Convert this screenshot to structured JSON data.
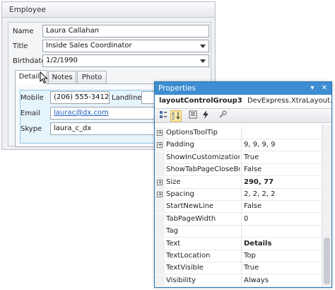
{
  "employee": {
    "group_title": "Employee",
    "name_label": "Name",
    "name_value": "Laura Callahan",
    "title_label": "Title",
    "title_value": "Inside Sales Coordinator",
    "birthdate_label": "Birthdate",
    "birthdate_value": "1/2/1990",
    "tabs": [
      {
        "label": "Details"
      },
      {
        "label": "Notes"
      },
      {
        "label": "Photo"
      }
    ],
    "mobile_label": "Mobile",
    "mobile_value": "(206) 555-3412",
    "landline_label": "Landline",
    "email_label": "Email",
    "email_value": "laurac@dx.com",
    "skype_label": "Skype",
    "skype_value": "laura_c_dx"
  },
  "properties": {
    "title": "Properties",
    "pin_glyph": "▾",
    "close_glyph": "✕",
    "object_name": "layoutControlGroup3",
    "object_type": "DevExpress.XtraLayout.Layout",
    "rows": [
      {
        "name": "OptionsToolTip",
        "value": "",
        "expandable": true
      },
      {
        "name": "Padding",
        "value": "9, 9, 9, 9",
        "expandable": true
      },
      {
        "name": "ShowInCustomization",
        "value": "True",
        "expandable": false
      },
      {
        "name": "ShowTabPageCloseBu",
        "value": "False",
        "expandable": false
      },
      {
        "name": "Size",
        "value": "290, 77",
        "expandable": true,
        "bold": true
      },
      {
        "name": "Spacing",
        "value": "2, 2, 2, 2",
        "expandable": true
      },
      {
        "name": "StartNewLine",
        "value": "False",
        "expandable": false
      },
      {
        "name": "TabPageWidth",
        "value": "0",
        "expandable": false
      },
      {
        "name": "Tag",
        "value": "",
        "expandable": false
      },
      {
        "name": "Text",
        "value": "Details",
        "expandable": false,
        "bold": true
      },
      {
        "name": "TextLocation",
        "value": "Top",
        "expandable": false
      },
      {
        "name": "TextVisible",
        "value": "True",
        "expandable": false
      },
      {
        "name": "Visibility",
        "value": "Always",
        "expandable": false
      }
    ]
  },
  "icons": {
    "categorized": "categorized-icon",
    "alphabetical": "sort-az-icon",
    "properties": "properties-icon",
    "events": "lightning-icon",
    "settings": "wrench-icon"
  }
}
